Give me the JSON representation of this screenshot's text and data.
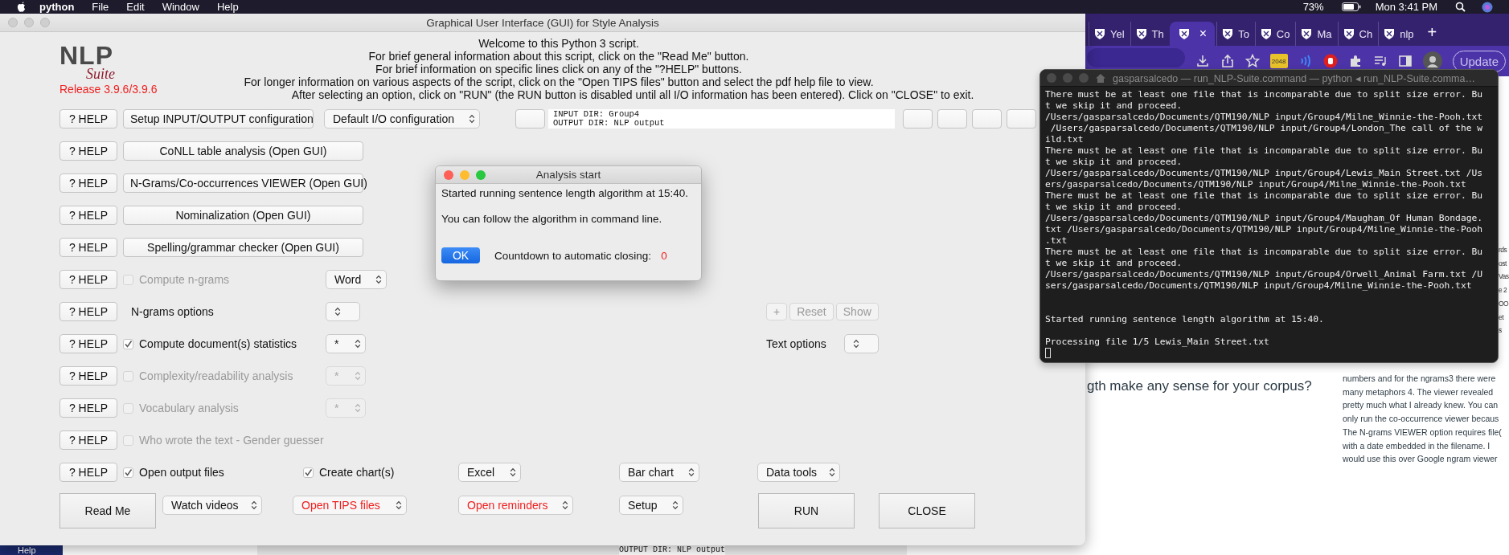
{
  "menu_bar": {
    "app": "python",
    "items": [
      "File",
      "Edit",
      "Window",
      "Help"
    ],
    "battery": "73%",
    "clock": "Mon 3:41 PM"
  },
  "browser": {
    "tabs": [
      {
        "label": "Yel",
        "selected": false
      },
      {
        "label": "Th",
        "selected": false
      },
      {
        "close": "×",
        "selected": true
      },
      {
        "label": "To",
        "selected": false
      },
      {
        "label": "Co",
        "selected": false
      },
      {
        "label": "Ma",
        "selected": false
      },
      {
        "label": "Ch",
        "selected": false
      },
      {
        "label": "nlp",
        "selected": false
      }
    ],
    "new_tab": "+",
    "extension_badge": "2048",
    "update_button": "Update",
    "page": {
      "heading": "gth make any sense for your corpus?",
      "fragments": [
        "rds",
        "ost",
        "Vas",
        "e 2",
        "OO",
        "et",
        "s"
      ],
      "paragraph_lines": [
        "numbers and for the ngrams3 there were",
        "many metaphors 4. The viewer revealed",
        "pretty much what I already knew. You can",
        "only run the co-occurrence viewer becaus",
        "The N-grams VIEWER option requires file(",
        "with a date embedded in the filename. I",
        "would use this over Google ngram viewer"
      ]
    }
  },
  "main": {
    "title": "Graphical User Interface (GUI) for Style Analysis",
    "logo": {
      "word": "NLP",
      "sub": "Suite",
      "release": "Release 3.9.6/3.9.6"
    },
    "welcome": [
      "Welcome to this Python 3 script.",
      "For brief general information about this script, click on the \"Read Me\" button.",
      "For brief information on specific lines click on any of the \"?HELP\" buttons.",
      "For longer information on various aspects of the script, click on the \"Open TIPS files\" button and select the pdf help file to view.",
      "After selecting an option, click on \"RUN\" (the RUN button is disabled until all I/O information has been entered).    Click on \"CLOSE\" to exit."
    ],
    "rows": [
      {
        "kind": "io",
        "help": "? HELP",
        "button": "Setup INPUT/OUTPUT configuration",
        "select": "Default I/O configuration",
        "io_lines": [
          "INPUT DIR: Group4",
          "OUTPUT DIR: NLP output"
        ]
      },
      {
        "kind": "button",
        "help": "? HELP",
        "button": "CoNLL table analysis (Open GUI)"
      },
      {
        "kind": "button",
        "help": "? HELP",
        "button": "N-Grams/Co-occurrences VIEWER (Open GUI)"
      },
      {
        "kind": "button",
        "help": "? HELP",
        "button": "Nominalization (Open GUI)"
      },
      {
        "kind": "button",
        "help": "? HELP",
        "button": "Spelling/grammar checker (Open GUI)"
      },
      {
        "kind": "check",
        "help": "? HELP",
        "label": "Compute n-grams",
        "checked": false,
        "disabled": true,
        "select": {
          "value": "Word",
          "disabled": false
        }
      },
      {
        "kind": "label",
        "help": "? HELP",
        "label": "N-grams options",
        "select": {
          "disabled": false
        },
        "buttons": [
          {
            "label": "+",
            "disabled": true
          },
          {
            "label": "Reset",
            "disabled": true
          },
          {
            "label": "Show",
            "disabled": true
          }
        ]
      },
      {
        "kind": "check",
        "help": "? HELP",
        "label": "Compute document(s) statistics",
        "checked": true,
        "disabled": false,
        "select": {
          "value": "*",
          "disabled": false
        },
        "text_options": {
          "label": "Text options",
          "select": {
            "disabled": false
          }
        }
      },
      {
        "kind": "check",
        "help": "? HELP",
        "label": "Complexity/readability analysis",
        "checked": false,
        "disabled": true,
        "select": {
          "value": "*",
          "disabled": true
        }
      },
      {
        "kind": "check",
        "help": "? HELP",
        "label": "Vocabulary analysis",
        "checked": false,
        "disabled": true,
        "select": {
          "value": "*",
          "disabled": true
        }
      },
      {
        "kind": "check",
        "help": "? HELP",
        "label": "Who wrote the text - Gender guesser",
        "checked": false,
        "disabled": true
      },
      {
        "kind": "outputs",
        "help": "? HELP",
        "checks": [
          {
            "label": "Open output files",
            "checked": true
          },
          {
            "label": "Create chart(s)",
            "checked": true
          }
        ],
        "selects": [
          "Excel",
          "Bar chart",
          "Data tools"
        ]
      }
    ],
    "bottom": {
      "read_me": "Read Me",
      "selects": [
        {
          "value": "Watch videos",
          "highlighted": false
        },
        {
          "value": "Open TIPS files",
          "highlighted": true
        },
        {
          "value": "Open reminders",
          "highlighted": true
        },
        {
          "value": "Setup",
          "highlighted": false
        }
      ],
      "run": "RUN",
      "close": "CLOSE"
    }
  },
  "dialog": {
    "title": "Analysis start",
    "lines": [
      "Started running sentence length algorithm at 15:40.",
      "You can follow the algorithm in command line."
    ],
    "ok": "OK",
    "countdown_label": "Countdown to automatic closing:",
    "countdown": "0"
  },
  "terminal": {
    "title": "gasparsalcedo — run_NLP-Suite.command — python ◂ run_NLP-Suite.comma…",
    "lines": [
      {
        "kind": "text",
        "text": "There must be at least one file that is incomparable due to split size error. Bu"
      },
      {
        "kind": "text",
        "text": "t we skip it and proceed."
      },
      {
        "kind": "text",
        "text": "/Users/gasparsalcedo/Documents/QTM190/NLP input/Group4/Milne_Winnie-the-Pooh.txt"
      },
      {
        "kind": "text",
        "text": " /Users/gasparsalcedo/Documents/QTM190/NLP input/Group4/London_The call of the w"
      },
      {
        "kind": "text",
        "text": "ild.txt"
      },
      {
        "kind": "text",
        "text": "There must be at least one file that is incomparable due to split size error. Bu"
      },
      {
        "kind": "text",
        "text": "t we skip it and proceed."
      },
      {
        "kind": "text",
        "text": "/Users/gasparsalcedo/Documents/QTM190/NLP input/Group4/Lewis_Main Street.txt /Us"
      },
      {
        "kind": "text",
        "text": "ers/gasparsalcedo/Documents/QTM190/NLP input/Group4/Milne_Winnie-the-Pooh.txt"
      },
      {
        "kind": "text",
        "text": "There must be at least one file that is incomparable due to split size error. Bu"
      },
      {
        "kind": "text",
        "text": "t we skip it and proceed."
      },
      {
        "kind": "text",
        "text": "/Users/gasparsalcedo/Documents/QTM190/NLP input/Group4/Maugham_Of Human Bondage."
      },
      {
        "kind": "text",
        "text": "txt /Users/gasparsalcedo/Documents/QTM190/NLP input/Group4/Milne_Winnie-the-Pooh"
      },
      {
        "kind": "text",
        "text": ".txt"
      },
      {
        "kind": "text",
        "text": "There must be at least one file that is incomparable due to split size error. Bu"
      },
      {
        "kind": "text",
        "text": "t we skip it and proceed."
      },
      {
        "kind": "text",
        "text": "/Users/gasparsalcedo/Documents/QTM190/NLP input/Group4/Orwell_Animal Farm.txt /U"
      },
      {
        "kind": "text",
        "text": "sers/gasparsalcedo/Documents/QTM190/NLP input/Group4/Milne_Winnie-the-Pooh.txt"
      },
      {
        "kind": "blank"
      },
      {
        "kind": "blank"
      },
      {
        "kind": "text",
        "text": "Started running sentence length algorithm at 15:40."
      },
      {
        "kind": "blank"
      },
      {
        "kind": "text",
        "text": "Processing file 1/5 Lewis_Main Street.txt"
      },
      {
        "kind": "cursor"
      }
    ]
  },
  "behind": {
    "dock_label": "Help",
    "output_text": "OUTPUT DIR: NLP output"
  }
}
